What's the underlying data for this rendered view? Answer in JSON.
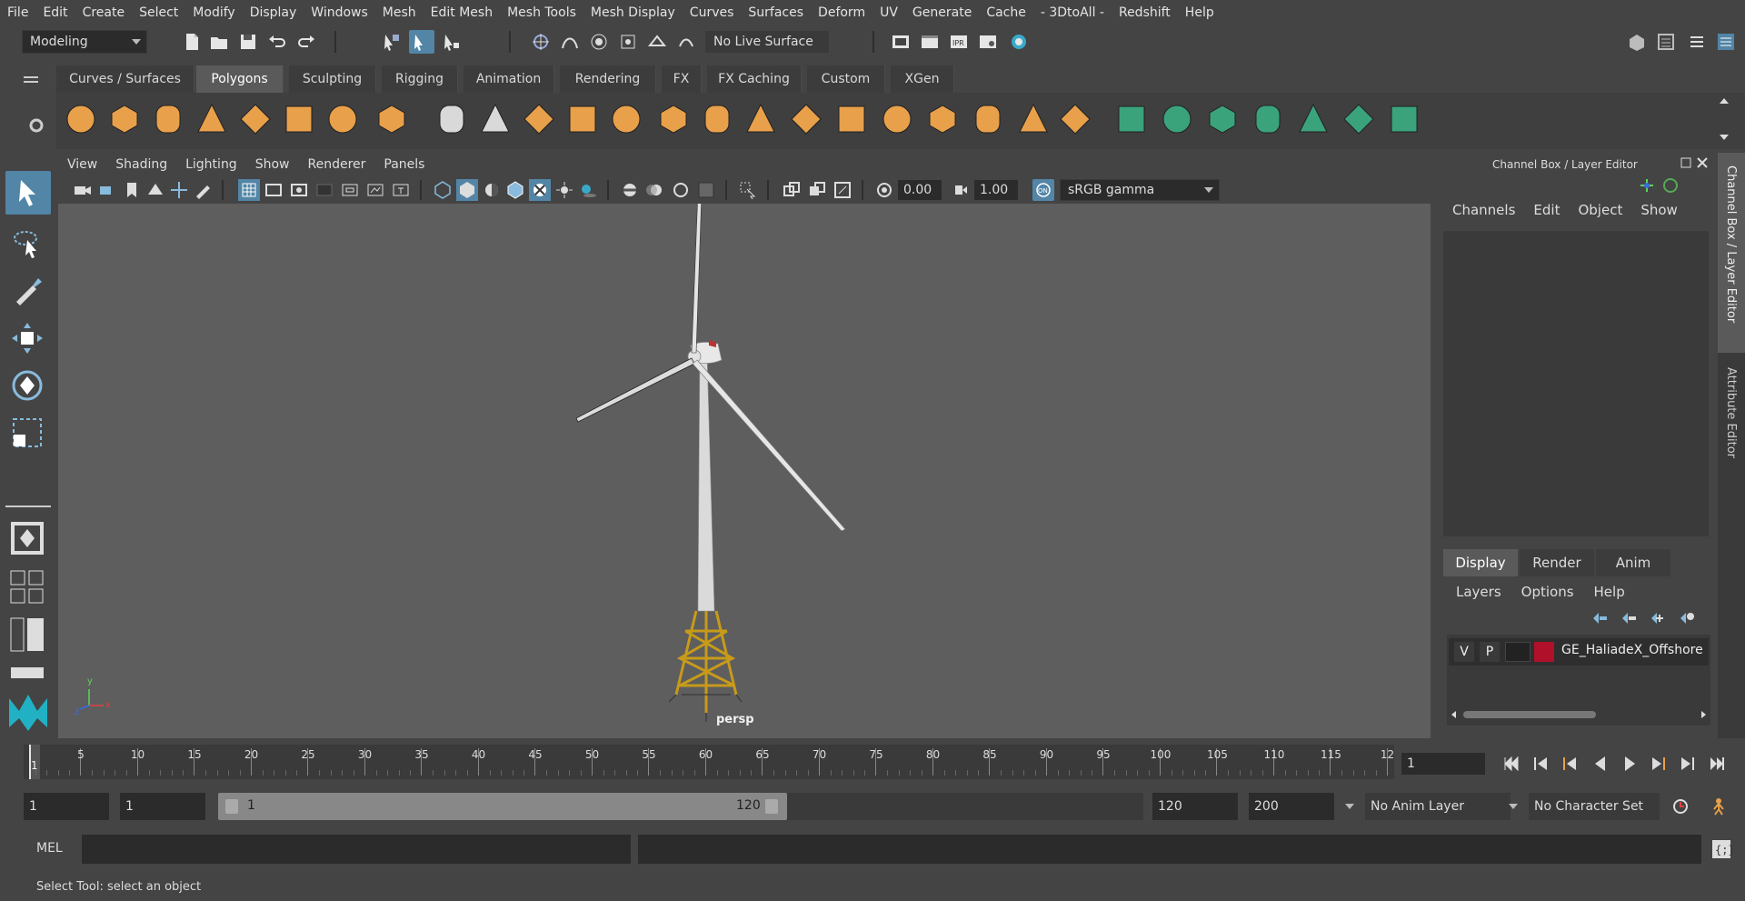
{
  "menubar": {
    "items": [
      "File",
      "Edit",
      "Create",
      "Select",
      "Modify",
      "Display",
      "Windows",
      "Mesh",
      "Edit Mesh",
      "Mesh Tools",
      "Mesh Display",
      "Curves",
      "Surfaces",
      "Deform",
      "UV",
      "Generate",
      "Cache",
      "- 3DtoAll -",
      "Redshift",
      "Help"
    ]
  },
  "statusline": {
    "mode_dropdown": "Modeling",
    "live_surface": "No Live Surface"
  },
  "shelf": {
    "tabs": [
      "Curves / Surfaces",
      "Polygons",
      "Sculpting",
      "Rigging",
      "Animation",
      "Rendering",
      "FX",
      "FX Caching",
      "Custom",
      "XGen"
    ],
    "active_tab": "Polygons"
  },
  "viewport": {
    "menu": [
      "View",
      "Shading",
      "Lighting",
      "Show",
      "Renderer",
      "Panels"
    ],
    "exposure": "0.00",
    "gamma": "1.00",
    "color_space": "sRGB gamma",
    "camera_label": "persp",
    "axis_x": "x",
    "axis_y": "y",
    "axis_z": "z"
  },
  "channel_box": {
    "title": "Channel Box / Layer Editor",
    "menu": [
      "Channels",
      "Edit",
      "Object",
      "Show"
    ]
  },
  "layer_editor": {
    "tabs": [
      "Display",
      "Render",
      "Anim"
    ],
    "active_tab": "Display",
    "menu": [
      "Layers",
      "Options",
      "Help"
    ],
    "layer": {
      "visible": "V",
      "playback": "P",
      "name": "GE_HaliadeX_Offshore",
      "color": "#b0102a"
    }
  },
  "side_tabs": [
    "Channel Box / Layer Editor",
    "Attribute Editor"
  ],
  "timeline": {
    "ticks": [
      "5",
      "10",
      "15",
      "20",
      "25",
      "30",
      "35",
      "40",
      "45",
      "50",
      "55",
      "60",
      "65",
      "70",
      "75",
      "80",
      "85",
      "90",
      "95",
      "100",
      "105",
      "110",
      "115",
      "12"
    ],
    "current_frame_marker": "1",
    "current_frame_field": "1"
  },
  "range": {
    "start": "1",
    "playback_start": "1",
    "slider_start": "1",
    "slider_end": "120",
    "playback_end": "120",
    "end": "200",
    "anim_layer": "No Anim Layer",
    "character_set": "No Character Set"
  },
  "command_line": {
    "label": "MEL"
  },
  "help_line": {
    "text": "Select Tool: select an object"
  },
  "colors": {
    "accent": "#5285a6",
    "shelf_orange": "#e8a04a",
    "shelf_green": "#3aa37c",
    "layer_red": "#b0102a"
  }
}
